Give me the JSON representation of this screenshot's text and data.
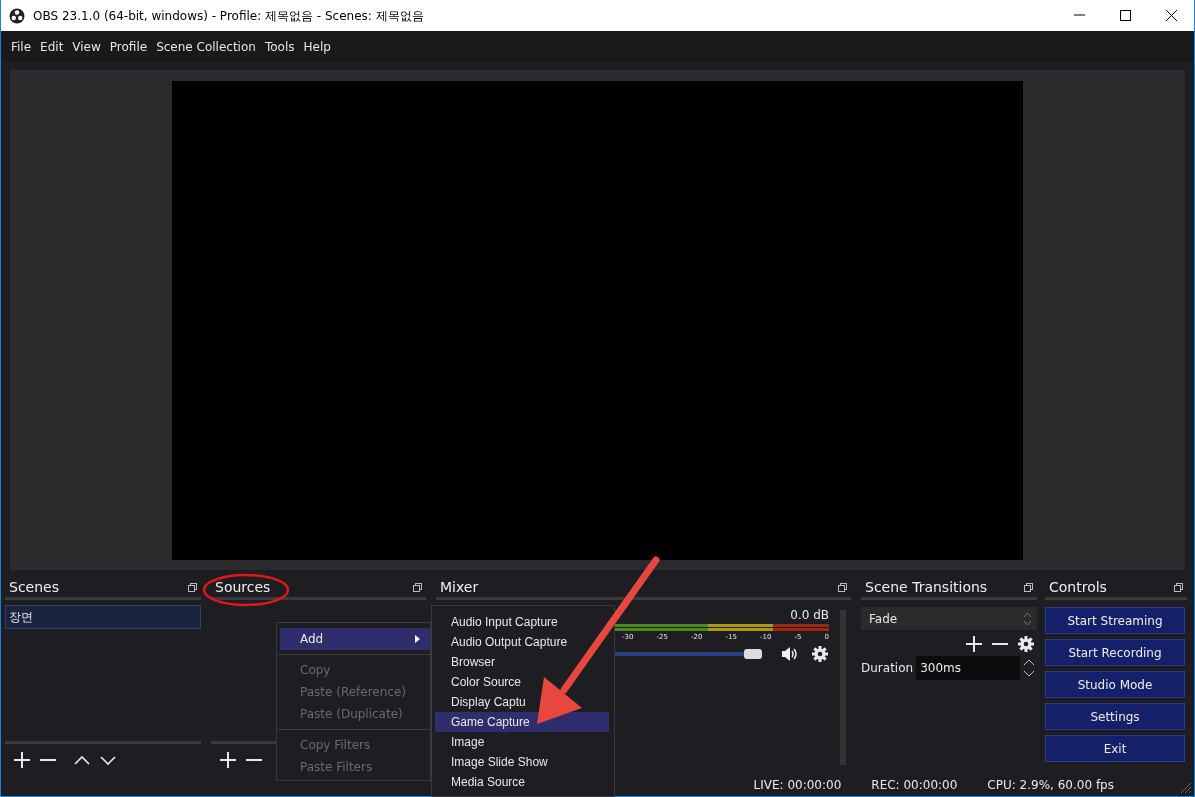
{
  "window": {
    "title": "OBS 23.1.0 (64-bit, windows) - Profile: 제목없음 - Scenes: 제목없음"
  },
  "menu": [
    "File",
    "Edit",
    "View",
    "Profile",
    "Scene Collection",
    "Tools",
    "Help"
  ],
  "scenes": {
    "title": "Scenes",
    "items": [
      {
        "label": "장면",
        "selected": true
      }
    ]
  },
  "sources": {
    "title": "Sources"
  },
  "mixer": {
    "title": "Mixer",
    "reading": "0.0 dB",
    "ticks": [
      "-30",
      "-25",
      "-20",
      "-15",
      "-10",
      "-5",
      "0"
    ],
    "level": 0.97
  },
  "transitions": {
    "title": "Scene Transitions",
    "transition": "Fade",
    "duration_label": "Duration",
    "duration": "300ms"
  },
  "controls": {
    "title": "Controls",
    "buttons": [
      "Start Streaming",
      "Start Recording",
      "Studio Mode",
      "Settings",
      "Exit"
    ]
  },
  "context_menu": [
    {
      "label": "Add",
      "kind": "submenu",
      "selected": true,
      "disabled": false
    },
    {
      "kind": "separator"
    },
    {
      "label": "Copy",
      "kind": "item",
      "selected": false,
      "disabled": true
    },
    {
      "label": "Paste (Reference)",
      "kind": "item",
      "selected": false,
      "disabled": true
    },
    {
      "label": "Paste (Duplicate)",
      "kind": "item",
      "selected": false,
      "disabled": true
    },
    {
      "kind": "separator"
    },
    {
      "label": "Copy Filters",
      "kind": "item",
      "selected": false,
      "disabled": true
    },
    {
      "label": "Paste Filters",
      "kind": "item",
      "selected": false,
      "disabled": true
    }
  ],
  "add_menu": [
    {
      "label": "Audio Input Capture",
      "selected": false
    },
    {
      "label": "Audio Output Capture",
      "selected": false
    },
    {
      "label": "Browser",
      "selected": false
    },
    {
      "label": "Color Source",
      "selected": false
    },
    {
      "label": "Display Captu",
      "selected": false
    },
    {
      "label": "Game Capture",
      "selected": true
    },
    {
      "label": "Image",
      "selected": false
    },
    {
      "label": "Image Slide Show",
      "selected": false
    },
    {
      "label": "Media Source",
      "selected": false
    }
  ],
  "status_bar": [
    "LIVE: 00:00:00",
    "REC: 00:00:00",
    "CPU: 2.9%, 60.00 fps"
  ]
}
